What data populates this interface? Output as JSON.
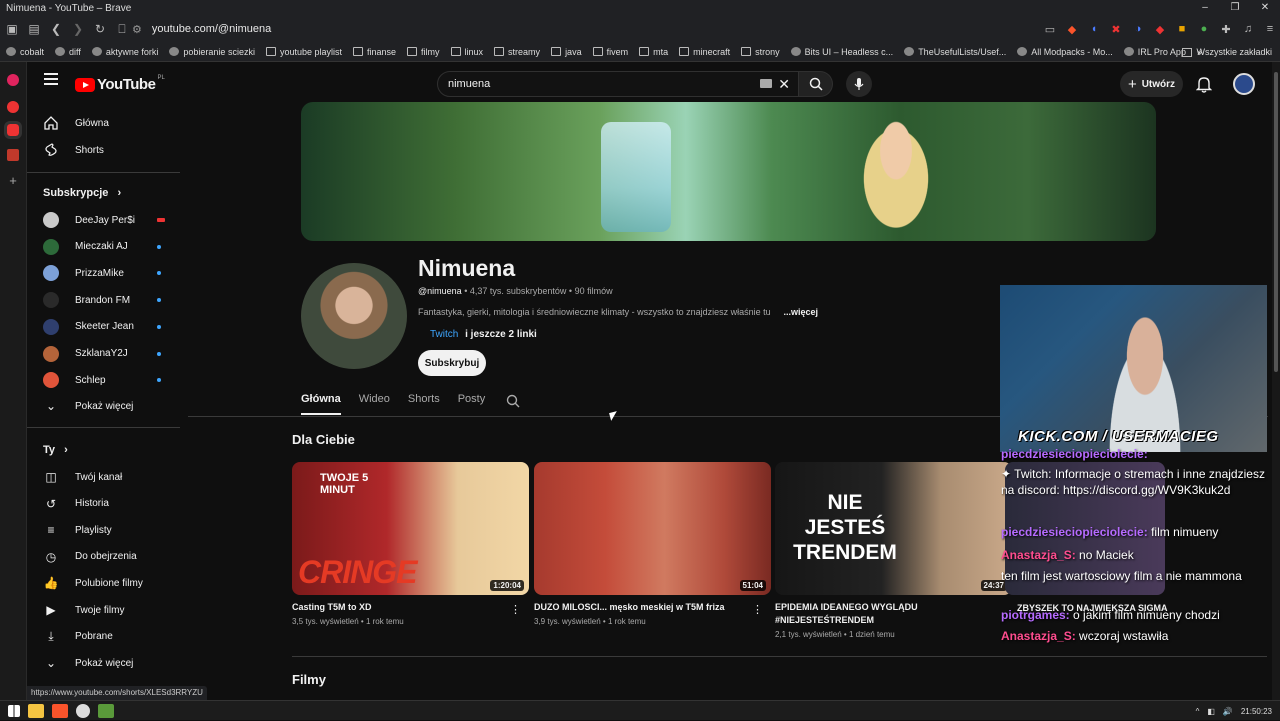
{
  "window": {
    "title": "Nimuena - YouTube – Brave"
  },
  "browser": {
    "url": "youtube.com/@nimuena",
    "bookmarks": [
      "cobalt",
      "diff",
      "aktywne forki",
      "pobieranie sciezki",
      "youtube playlist",
      "finanse",
      "filmy",
      "linux",
      "streamy",
      "java",
      "fivem",
      "mta",
      "minecraft",
      "strony",
      "Bits UI – Headless c...",
      "TheUsefulLists/Usef...",
      "All Modpacks - Mo...",
      "IRL Pro App"
    ],
    "bookmarks_right": "Wszystkie zakładki",
    "status_url": "https://www.youtube.com/shorts/XLESd3RRYZU"
  },
  "youtube": {
    "logo_text": "YouTube",
    "region": "PL",
    "search_value": "nimuena",
    "create_label": "Utwórz",
    "nav": {
      "main": [
        {
          "label": "Główna"
        },
        {
          "label": "Shorts"
        }
      ],
      "subscriptions_header": "Subskrypcje",
      "subscriptions": [
        {
          "label": "DeeJay Per$i",
          "color": "#c9c9c9"
        },
        {
          "label": "Mieczaki AJ",
          "color": "#2d6a3a"
        },
        {
          "label": "PrizzaMike",
          "color": "#7da1d8"
        },
        {
          "label": "Brandon FM",
          "color": "#2a2a2a"
        },
        {
          "label": "Skeeter Jean",
          "color": "#2f3f6e"
        },
        {
          "label": "SzklanaY2J",
          "color": "#b4643a"
        },
        {
          "label": "Schlep",
          "color": "#e0543a"
        }
      ],
      "show_more": "Pokaż więcej",
      "you_header": "Ty",
      "you": [
        {
          "label": "Twój kanał"
        },
        {
          "label": "Historia"
        },
        {
          "label": "Playlisty"
        },
        {
          "label": "Do obejrzenia"
        },
        {
          "label": "Polubione filmy"
        },
        {
          "label": "Twoje filmy"
        },
        {
          "label": "Pobrane"
        },
        {
          "label": "Pokaż więcej"
        }
      ]
    },
    "channel": {
      "name": "Nimuena",
      "handle": "@nimuena",
      "subscribers": "4,37 tys. subskrybentów",
      "videos_count": "90 filmów",
      "description": "Fantastyka, gierki, mitologia i średniowieczne klimaty - wszystko to znajdziesz właśnie tu",
      "more": "...więcej",
      "link_name": "Twitch",
      "links_more": "i jeszcze 2 linki",
      "subscribe_label": "Subskrybuj"
    },
    "tabs": [
      "Główna",
      "Wideo",
      "Shorts",
      "Posty"
    ],
    "section_for_you": "Dla Ciebie",
    "section_videos": "Filmy",
    "videos": [
      {
        "title": "Casting T5M to XD",
        "meta": "3,5 tys. wyświetleń • 1 rok temu",
        "duration": "1:20:04",
        "thumb_text": "CRINGE",
        "thumb_top": "TWOJE 5 MINUT"
      },
      {
        "title": "DUZO MILOSCI... męsko meskiej w T5M friza",
        "meta": "3,9 tys. wyświetleń • 1 rok temu",
        "duration": "51:04"
      },
      {
        "title": "EPIDEMIA IDEANEGO WYGLĄDU #NIEJESTEŚTRENDEM",
        "meta": "2,1 tys. wyświetleń • 1 dzień temu",
        "duration": "24:37",
        "thumb_text": "NIE JESTEŚ TRENDEM"
      }
    ]
  },
  "overlay": {
    "kick": "KICK.COM / USERMACIEG",
    "chat": [
      {
        "user": "piecdziesieciopieciolecie:",
        "text": ""
      },
      {
        "user": "",
        "text": "✦ Twitch: Informacje o stremach i inne znajdziesz na discord: https://discord.gg/WV9K3kuk2d"
      },
      {
        "user": "piecdziesieciopieciolecie:",
        "text": " film nimueny"
      },
      {
        "user": "Anastazja_S:",
        "text": " no Maciek"
      },
      {
        "user": "",
        "text": "ten film jest wartosciowy film a nie mammona"
      },
      {
        "user": "piotrgames:",
        "text": " o jakim film nimueny chodzi"
      },
      {
        "user": "Anastazja_S:",
        "text": " wczoraj wstawiła"
      }
    ],
    "fourth_video_title": "ZBYSZEK TO NAJWIĘKSZA SIGMA"
  },
  "taskbar": {
    "time": "21:50:23"
  }
}
